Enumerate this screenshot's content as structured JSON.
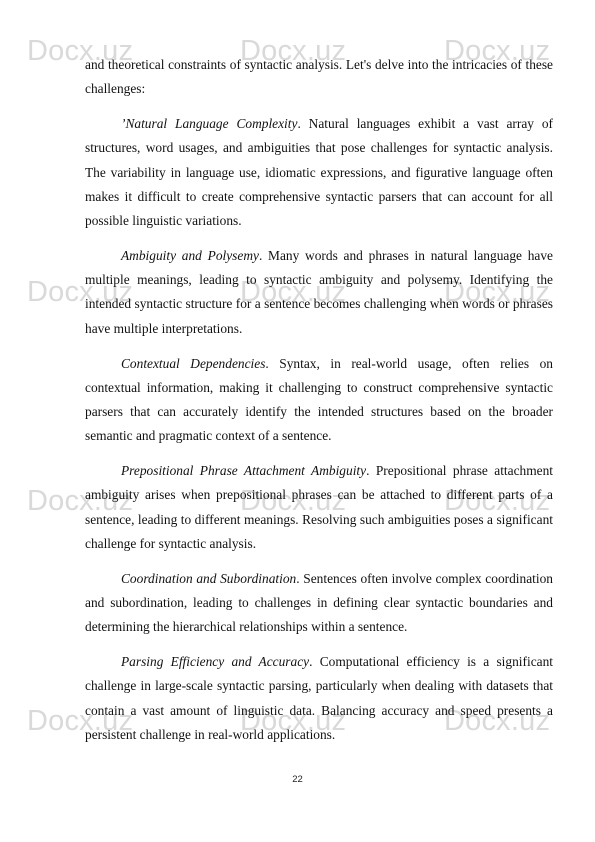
{
  "watermark": {
    "text": "Docx.uz",
    "color": "#d9d9d9"
  },
  "paragraphs": [
    {
      "heading": "",
      "text": "and theoretical constraints of syntactic analysis. Let's delve into the intricacies of these challenges:"
    },
    {
      "heading": "’Natural Language Complexity",
      "text": ". Natural languages exhibit a vast array of structures, word usages, and ambiguities that pose challenges for syntactic analysis. The variability in language use, idiomatic expressions, and figurative language often makes it difficult to create comprehensive syntactic parsers that can account for all possible linguistic variations."
    },
    {
      "heading": "Ambiguity and Polysemy",
      "text": ". Many words and phrases in natural language have multiple meanings, leading to syntactic ambiguity and polysemy. Identifying the intended syntactic structure for a sentence becomes challenging when words or phrases have multiple interpretations."
    },
    {
      "heading": "Contextual Dependencies",
      "text": ". Syntax, in real-world usage, often relies on contextual information, making it challenging to construct comprehensive syntactic parsers that can accurately identify the intended structures based on the broader semantic and pragmatic context of a sentence."
    },
    {
      "heading": "Prepositional Phrase Attachment Ambiguity",
      "text": ". Prepositional phrase attachment ambiguity arises when prepositional phrases can be attached to different parts of a sentence, leading to different meanings. Resolving such ambiguities poses a significant challenge for syntactic analysis."
    },
    {
      "heading": "Coordination and Subordination",
      "text": ". Sentences often involve complex coordination and subordination, leading to challenges in defining clear syntactic boundaries and determining the hierarchical relationships within a sentence."
    },
    {
      "heading": "Parsing Efficiency and Accuracy",
      "text": ". Computational efficiency is a significant challenge in large-scale syntactic parsing, particularly when dealing with datasets that contain a vast amount of linguistic data. Balancing accuracy and speed presents a persistent challenge in real-world applications."
    }
  ],
  "page_number": "22"
}
